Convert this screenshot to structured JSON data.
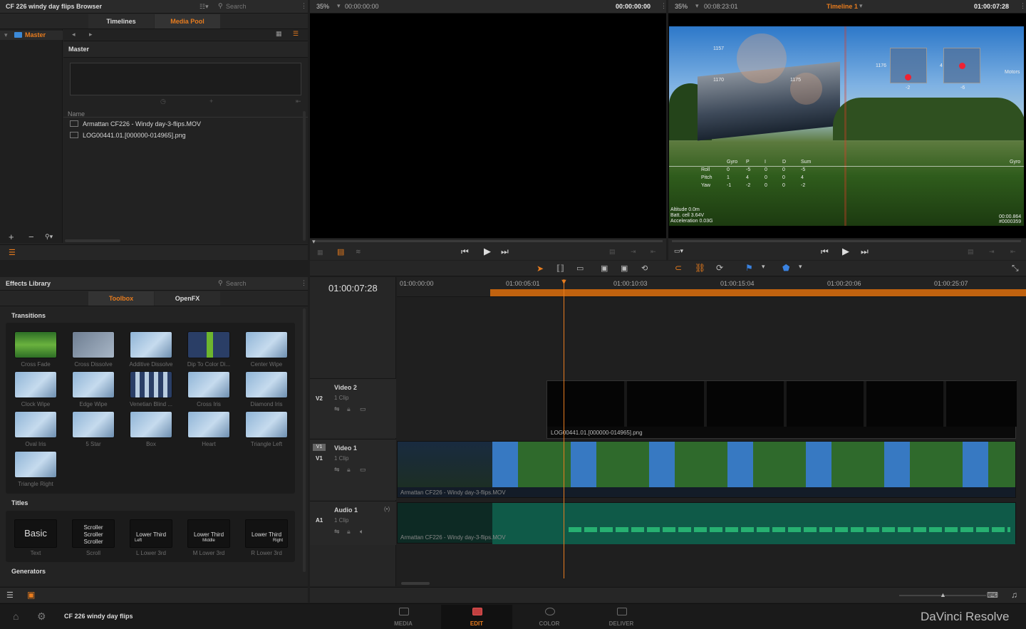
{
  "browser": {
    "title": "CF 226 windy day flips Browser",
    "search_placeholder": "Search",
    "tabs": [
      "Timelines",
      "Media Pool"
    ],
    "tree_root": "Master",
    "bin_title": "Master",
    "column_name": "Name",
    "files": [
      "Armattan CF226 - Windy day-3-flips.MOV",
      "LOG00441.01.[000000-014965].png"
    ]
  },
  "source_viewer": {
    "zoom": "35%",
    "timecode_left": "00:00:00:00",
    "timecode_right": "00:00:00:00"
  },
  "timeline_viewer": {
    "zoom": "35%",
    "timecode_left": "00:08:23:01",
    "timeline_name": "Timeline 1",
    "timecode_right": "01:00:07:28",
    "overlay": {
      "numbers": [
        "1157",
        "1170",
        "1175",
        "1176",
        "4",
        "-2",
        "-6"
      ],
      "motors_label": "Motors",
      "gyro_label": "Gyro",
      "table_headers": [
        "Gyro",
        "P",
        "I",
        "D",
        "Sum"
      ],
      "table_rows": [
        {
          "axis": "Roll",
          "vals": [
            "0",
            "-5",
            "0",
            "0",
            "-5"
          ]
        },
        {
          "axis": "Pitch",
          "vals": [
            "1",
            "4",
            "0",
            "0",
            "4"
          ]
        },
        {
          "axis": "Yaw",
          "vals": [
            "-1",
            "-2",
            "0",
            "0",
            "-2"
          ]
        }
      ],
      "altitude": "Altitude 0.0m",
      "batt": "Batt. cell 3.64V",
      "accel": "Acceleration 0.03G",
      "time": "00:00.864",
      "frame": "#0000359"
    }
  },
  "effects": {
    "title": "Effects Library",
    "search_placeholder": "Search",
    "tabs": [
      "Toolbox",
      "OpenFX"
    ],
    "transitions_heading": "Transitions",
    "transitions": [
      "Cross Fade",
      "Cross Dissolve",
      "Additive Dissolve",
      "Dip To Color Di...",
      "Center Wipe",
      "Clock Wipe",
      "Edge Wipe",
      "Venetian Blind ...",
      "Cross Iris",
      "Diamond Iris",
      "Oval Iris",
      "5 Star",
      "Box",
      "Heart",
      "Triangle Left",
      "Triangle Right"
    ],
    "titles_heading": "Titles",
    "titles": [
      {
        "preview": "Basic",
        "preview_sub": "",
        "label": "Text"
      },
      {
        "preview": "Scroller Scroller Scroller",
        "preview_sub": "",
        "label": "Scroll"
      },
      {
        "preview": "Lower Third",
        "preview_sub": "Left",
        "label": "L Lower 3rd"
      },
      {
        "preview": "Lower Third",
        "preview_sub": "Middle",
        "label": "M Lower 3rd"
      },
      {
        "preview": "Lower Third",
        "preview_sub": "Right",
        "label": "R Lower 3rd"
      }
    ],
    "generators_heading": "Generators"
  },
  "timeline": {
    "current_tc": "01:00:07:28",
    "ruler": [
      "01:00:00:00",
      "01:00:05:01",
      "01:00:10:03",
      "01:00:15:04",
      "01:00:20:06",
      "01:00:25:07"
    ],
    "tracks": [
      {
        "id": "V2",
        "name": "Video 2",
        "clips": "1 Clip"
      },
      {
        "id": "V1",
        "name": "Video 1",
        "clips": "1 Clip"
      },
      {
        "id": "A1",
        "name": "Audio 1",
        "clips": "1 Clip"
      }
    ],
    "v2_clip_name": "LOG00441.01.[000000-014965].png",
    "v1_clip_name": "Armattan CF226 - Windy day-3-flips.MOV",
    "a1_clip_name": "Armattan CF226 - Windy day-3-flips.MOV"
  },
  "footer": {
    "project": "CF 226 windy day flips",
    "pages": [
      "MEDIA",
      "EDIT",
      "COLOR",
      "DELIVER"
    ],
    "brand": "DaVinci Resolve"
  },
  "colors": {
    "accent": "#e87c1e",
    "bg": "#1e1e1e",
    "panel": "#232323",
    "audio": "#0f5a48"
  }
}
